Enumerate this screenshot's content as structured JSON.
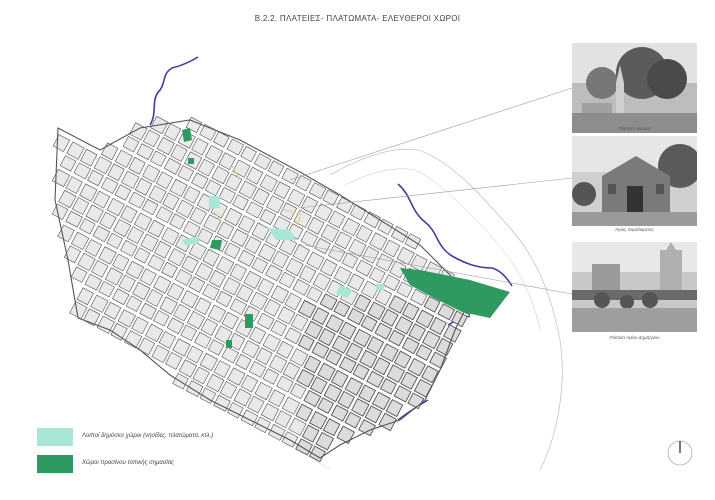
{
  "title": "Β.2.2. ΠΛΑΤΕΙΕΣ- ΠΛΑΤΩΜΑΤΑ- ΕΛΕΥΘΕΡΟΙ ΧΩΡΟΙ",
  "photos": [
    {
      "caption": "Πλατεία Ηρώων"
    },
    {
      "caption": "Άγιος Χαράλαμπος"
    },
    {
      "caption": "Πλατεία Αγίου Δημητρίου"
    }
  ],
  "legend": [
    {
      "label": "Λοιποί δημόσιοι χώροι (νησίδες, πλατώματα, κτλ.)",
      "color": "#a8e6d6"
    },
    {
      "label": "Χώροι πρασίνου τοπικής σημασίας",
      "color": "#2e9a62"
    }
  ],
  "colors": {
    "street": "#555555",
    "block_fill": "#e9e9e9",
    "river": "#3b3fa5",
    "leader": "#9a9a9a",
    "yellow_path": "#d8c14a"
  }
}
